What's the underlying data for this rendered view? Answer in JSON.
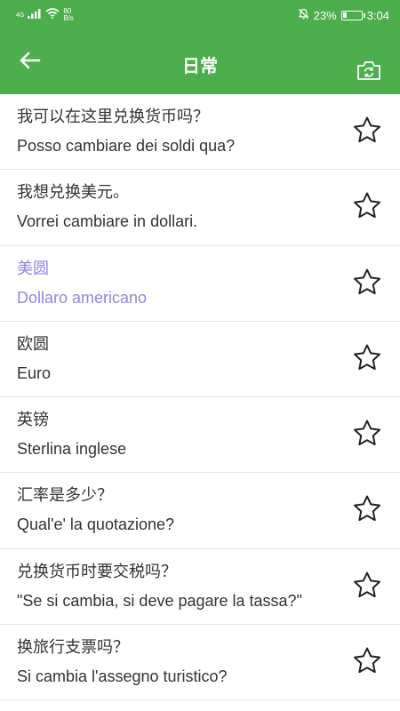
{
  "status_bar": {
    "network_type": "4G",
    "speed_value": "80",
    "speed_unit": "B/s",
    "battery_percent": "23%",
    "battery_level": 0.23,
    "time": "3:04",
    "icons": [
      "signal-icon",
      "wifi-icon",
      "mute-icon",
      "battery-icon"
    ]
  },
  "app_bar": {
    "title": "日常",
    "back_icon": "arrow-left-icon",
    "camera_icon": "switch-camera-icon",
    "color": "#4cae4c"
  },
  "phrases": [
    {
      "zh": "我可以在这里兑换货币吗？",
      "it": "Posso cambiare dei soldi qua?",
      "highlighted": false
    },
    {
      "zh": "我想兑换美元。",
      "it": "Vorrei cambiare in dollari.",
      "highlighted": false
    },
    {
      "zh": "美圆",
      "it": "Dollaro americano",
      "highlighted": true
    },
    {
      "zh": "欧圆",
      "it": "Euro",
      "highlighted": false
    },
    {
      "zh": "英镑",
      "it": "Sterlina inglese",
      "highlighted": false
    },
    {
      "zh": "汇率是多少？",
      "it": "Qual'e' la quotazione?",
      "highlighted": false
    },
    {
      "zh": "兑换货币时要交税吗？",
      "it": "\"Se si cambia, si deve pagare la tassa?\"",
      "highlighted": false
    },
    {
      "zh": "换旅行支票吗？",
      "it": "Si cambia l'assegno turistico?",
      "highlighted": false
    }
  ],
  "colors": {
    "highlight_text": "#8c88e8",
    "star_outline": "#222222"
  }
}
